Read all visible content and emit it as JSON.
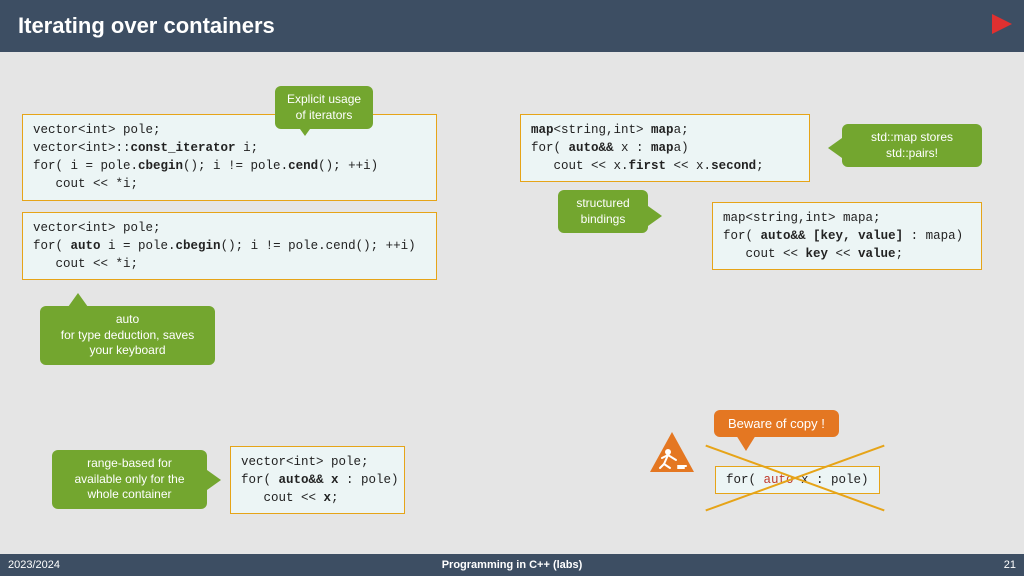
{
  "header": {
    "title": "Iterating over containers"
  },
  "footer": {
    "year": "2023/2024",
    "course": "Programming in C++ (labs)",
    "page": "21"
  },
  "code": {
    "c1": "vector<int> pole;\nvector<int>::const_iterator i;\nfor( i = pole.cbegin(); i != pole.cend(); ++i)\n   cout << *i;",
    "c2": "vector<int> pole;\nfor( auto i = pole.cbegin(); i != pole.cend(); ++i)\n   cout << *i;",
    "c3": "vector<int> pole;\nfor( auto&& x : pole)\n   cout << x;",
    "c4": "map<string,int> mapa;\nfor( auto&& x : mapa)\n   cout << x.first << x.second;",
    "c5": "map<string,int> mapa;\nfor( auto&& [key, value] : mapa)\n   cout << key << value;",
    "c6_pre": "for( ",
    "c6_auto": "auto",
    "c6_post": " x : pole)"
  },
  "labels": {
    "explicit": "Explicit usage\nof iterators",
    "auto": "auto\nfor type deduction, saves\nyour keyboard",
    "range": "range-based for\navailable only for the\nwhole container",
    "structured": "structured\nbindings",
    "mapstores": "std::map stores\nstd::pairs!",
    "beware": "Beware of copy !"
  }
}
